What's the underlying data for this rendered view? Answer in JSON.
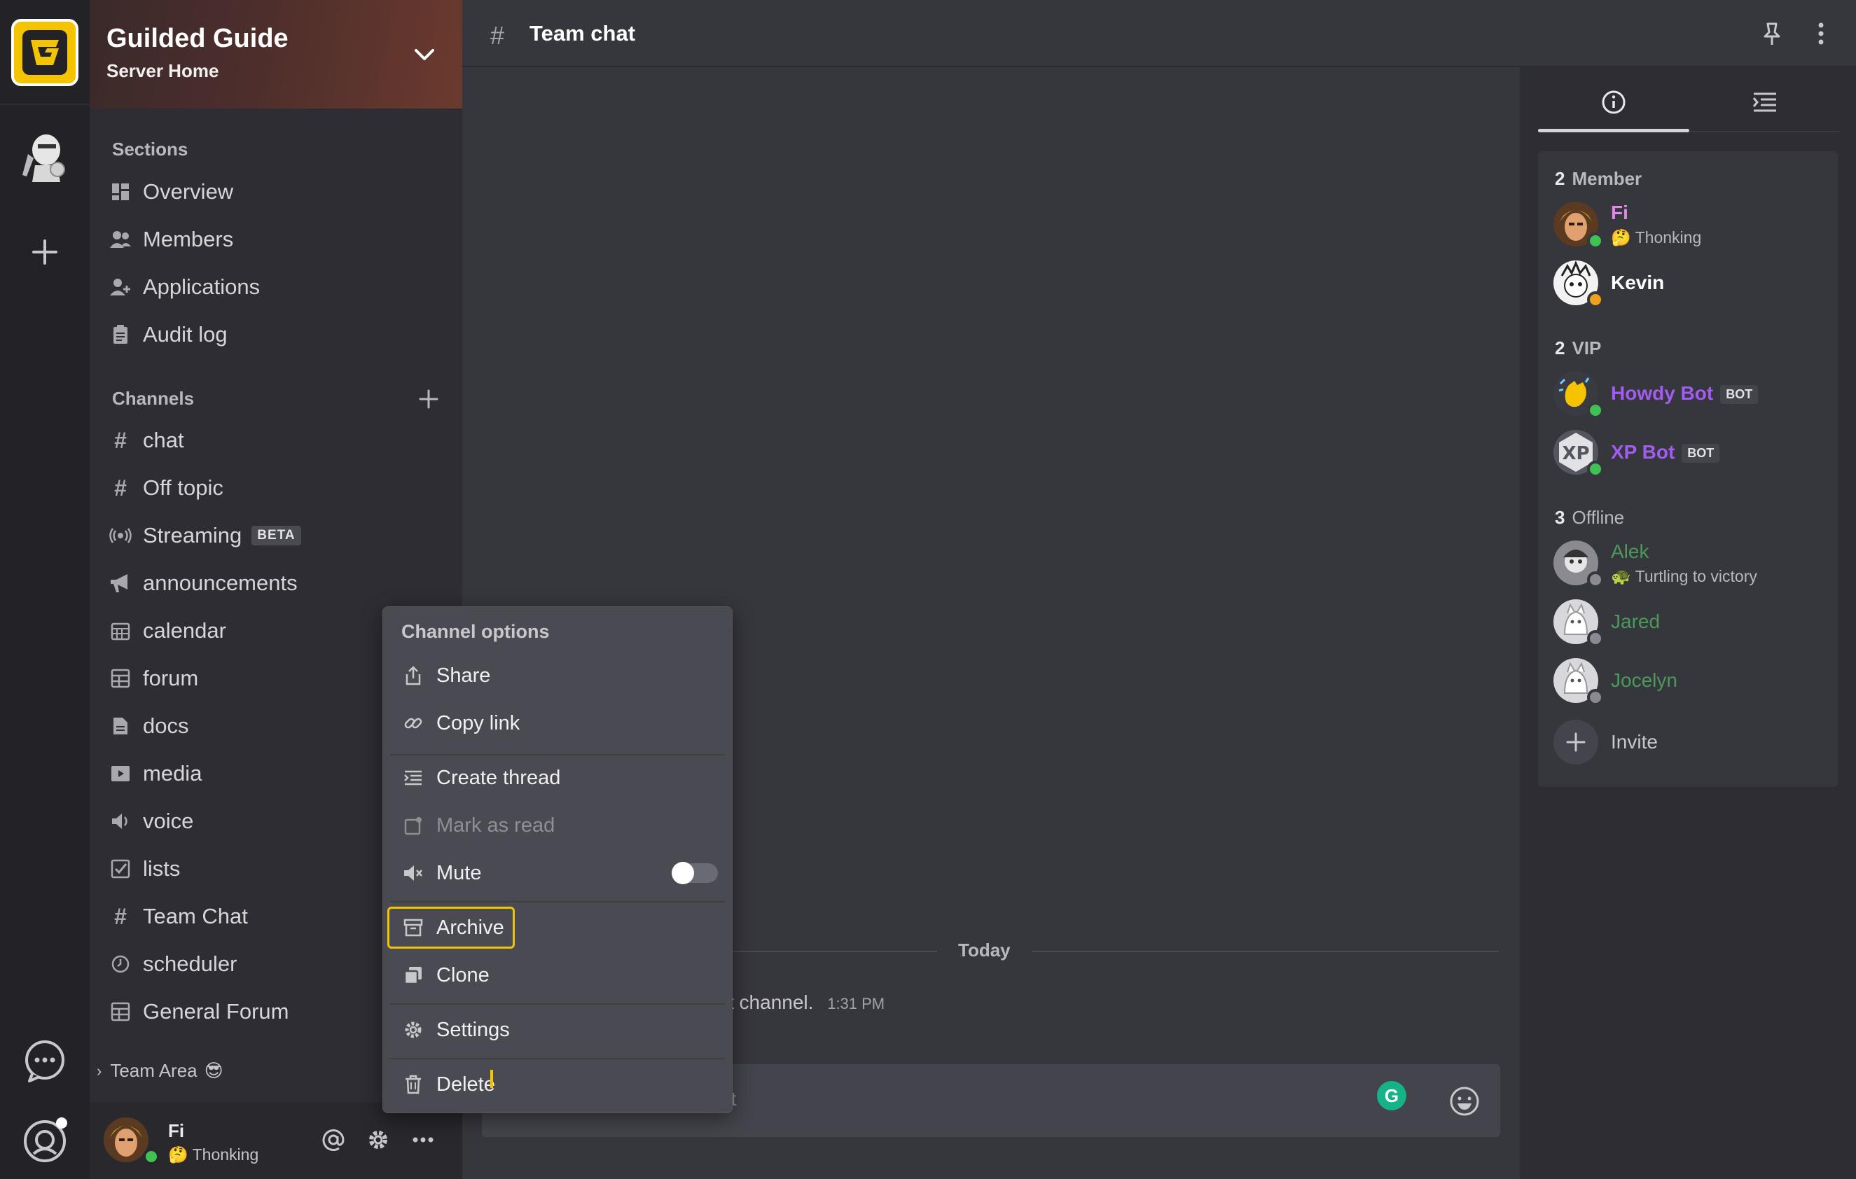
{
  "server": {
    "name": "Guilded Guide",
    "subtitle": "Server Home"
  },
  "sections": {
    "heading": "Sections",
    "items": [
      {
        "label": "Overview",
        "icon": "dashboard-icon"
      },
      {
        "label": "Members",
        "icon": "members-icon"
      },
      {
        "label": "Applications",
        "icon": "applications-icon"
      },
      {
        "label": "Audit log",
        "icon": "clipboard-icon"
      }
    ]
  },
  "channels": {
    "heading": "Channels",
    "items": [
      {
        "label": "chat",
        "icon": "hash-icon"
      },
      {
        "label": "Off topic",
        "icon": "hash-icon"
      },
      {
        "label": "Streaming",
        "icon": "broadcast-icon",
        "badge": "BETA"
      },
      {
        "label": "announcements",
        "icon": "megaphone-icon"
      },
      {
        "label": "calendar",
        "icon": "calendar-icon"
      },
      {
        "label": "forum",
        "icon": "forum-icon"
      },
      {
        "label": "docs",
        "icon": "document-icon"
      },
      {
        "label": "media",
        "icon": "media-icon"
      },
      {
        "label": "voice",
        "icon": "speaker-icon"
      },
      {
        "label": "lists",
        "icon": "checkbox-icon"
      },
      {
        "label": "Team Chat",
        "icon": "hash-icon"
      },
      {
        "label": "scheduler",
        "icon": "clock-icon"
      },
      {
        "label": "General Forum",
        "icon": "forum-icon"
      }
    ]
  },
  "team_area": {
    "label": "Team Area",
    "emoji": "😎"
  },
  "current_user": {
    "name": "Fi",
    "status_emoji": "🤔",
    "status": "Thonking"
  },
  "topbar": {
    "hash": "#",
    "title": "Team chat"
  },
  "chat": {
    "day_label": "Today",
    "message_text": "t channel.",
    "message_time": "1:31 PM",
    "composer_placeholder": "at"
  },
  "context_menu": {
    "title": "Channel options",
    "items": [
      {
        "label": "Share",
        "icon": "share-icon"
      },
      {
        "label": "Copy link",
        "icon": "link-icon"
      },
      {
        "label": "Create thread",
        "icon": "thread-icon"
      },
      {
        "label": "Mark as read",
        "icon": "mark-read-icon",
        "disabled": true
      },
      {
        "label": "Mute",
        "icon": "mute-icon",
        "toggle": false
      },
      {
        "label": "Archive",
        "icon": "archive-icon",
        "focused": true
      },
      {
        "label": "Clone",
        "icon": "clone-icon"
      },
      {
        "label": "Settings",
        "icon": "gear-icon"
      },
      {
        "label": "Delete",
        "icon": "trash-icon"
      }
    ]
  },
  "members_panel": {
    "groups": [
      {
        "count": "2",
        "title": "Member"
      },
      {
        "count": "2",
        "title": "VIP"
      },
      {
        "count": "3",
        "title": "Offline"
      }
    ],
    "members": [
      {
        "name": "Fi",
        "status_emoji": "🤔",
        "status": "Thonking",
        "color": "#e08ae6",
        "presence": "#3fc153"
      },
      {
        "name": "Kevin",
        "color": "#ffffff",
        "presence": "#f0a020"
      },
      {
        "name": "Howdy Bot",
        "badge": "BOT",
        "color": "#a35cf0",
        "presence": "#3fc153"
      },
      {
        "name": "XP Bot",
        "badge": "BOT",
        "color": "#a35cf0",
        "presence": "#3fc153"
      },
      {
        "name": "Alek",
        "status_emoji": "🐢",
        "status": "Turtling to victory",
        "color": "#4c9a5a",
        "presence": "#8a8a90"
      },
      {
        "name": "Jared",
        "color": "#4c9a5a",
        "presence": "#8a8a90"
      },
      {
        "name": "Jocelyn",
        "color": "#4c9a5a",
        "presence": "#8a8a90"
      }
    ],
    "invite_label": "Invite"
  },
  "colors": {
    "accent": "#f5c400",
    "online": "#3fc153",
    "bot_name": "#a35cf0",
    "offline_name": "#4c9a5a"
  }
}
